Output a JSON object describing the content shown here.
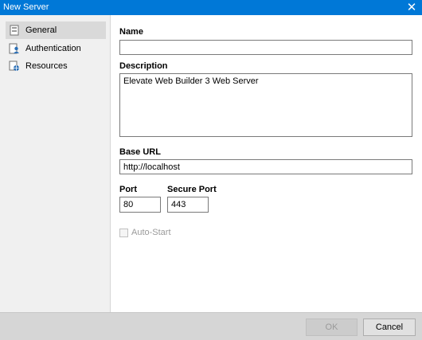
{
  "window": {
    "title": "New Server",
    "close_glyph": "✕"
  },
  "sidebar": {
    "items": [
      {
        "label": "General",
        "icon": "page-icon",
        "selected": true
      },
      {
        "label": "Authentication",
        "icon": "user-icon",
        "selected": false
      },
      {
        "label": "Resources",
        "icon": "resources-icon",
        "selected": false
      }
    ]
  },
  "form": {
    "name_label": "Name",
    "name_value": "",
    "description_label": "Description",
    "description_value": "Elevate Web Builder 3 Web Server",
    "base_url_label": "Base URL",
    "base_url_value": "http://localhost",
    "port_label": "Port",
    "port_value": "80",
    "secure_port_label": "Secure Port",
    "secure_port_value": "443",
    "auto_start_label": "Auto-Start",
    "auto_start_checked": false
  },
  "footer": {
    "ok_label": "OK",
    "cancel_label": "Cancel"
  },
  "colors": {
    "titlebar": "#0078d7",
    "sidebar_bg": "#f0f0f0",
    "selected_item": "#d9d9d9",
    "footer_bg": "#d6d6d6"
  }
}
